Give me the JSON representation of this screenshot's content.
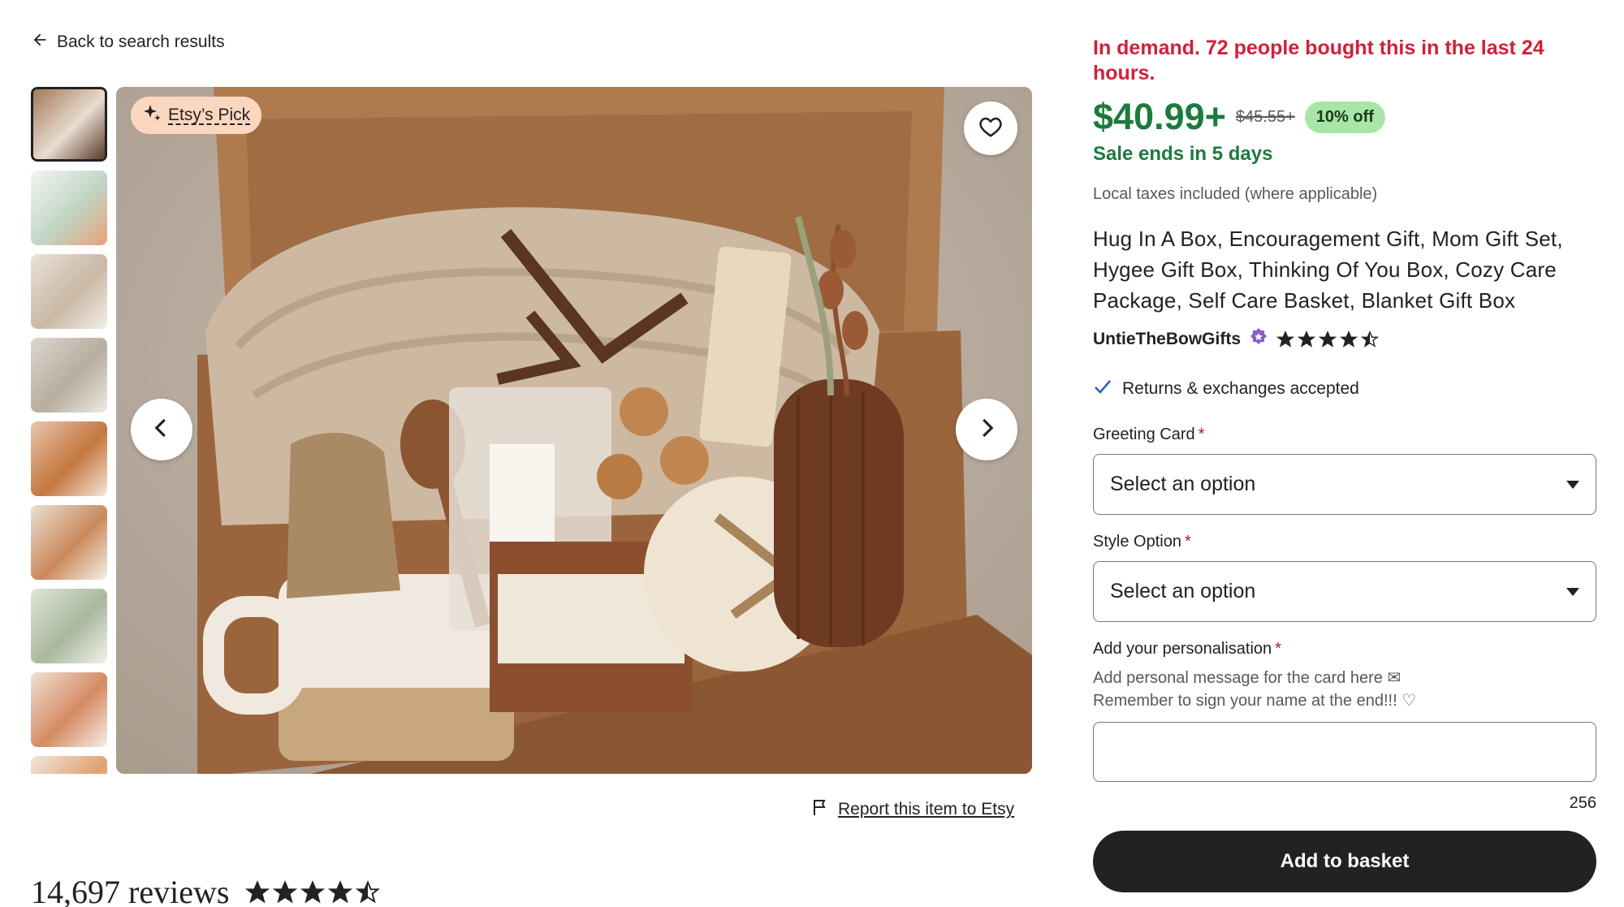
{
  "nav": {
    "back_label": "Back to search results",
    "back_icon": "arrow-left-icon"
  },
  "gallery": {
    "badge_label": "Etsy’s Pick",
    "thumbnails": [
      {
        "colors": [
          "#a27a5a",
          "#e8dcd0",
          "#5a3a28"
        ]
      },
      {
        "colors": [
          "#f4f4f2",
          "#bfd6c4",
          "#e8a07a"
        ]
      },
      {
        "colors": [
          "#e9e2d8",
          "#c9b8a4",
          "#f3eee7"
        ]
      },
      {
        "colors": [
          "#dcd7cf",
          "#b7ad9f",
          "#efebe4"
        ]
      },
      {
        "colors": [
          "#e8c6ae",
          "#c4773e",
          "#f5e6d8"
        ]
      },
      {
        "colors": [
          "#eadfd3",
          "#c98a5b",
          "#f6efe7"
        ]
      },
      {
        "colors": [
          "#dfe6d8",
          "#a9b89d",
          "#f1f3ec"
        ]
      },
      {
        "colors": [
          "#efe1d6",
          "#d48a62",
          "#f7eee7"
        ]
      },
      {
        "colors": [
          "#f2e6da",
          "#e0a070",
          "#fbf3ec"
        ]
      }
    ]
  },
  "report": {
    "label": "Report this item to Etsy"
  },
  "reviews": {
    "count_label": "14,697 reviews",
    "rating": 4.5
  },
  "listing": {
    "demand_text": "In demand. 72 people bought this in the last 24 hours.",
    "price": "$40.99+",
    "old_price": "$45.55+",
    "discount_badge": "10% off",
    "sale_ends": "Sale ends in 5 days",
    "taxes_note": "Local taxes included (where applicable)",
    "title": "Hug In A Box, Encouragement Gift, Mom Gift Set, Hygee Gift Box, Thinking Of You Box, Cozy Care Package, Self Care Basket, Blanket Gift Box",
    "shop_name": "UntieTheBowGifts",
    "shop_rating": 4.5,
    "returns_text": "Returns & exchanges accepted"
  },
  "form": {
    "greeting_card_label": "Greeting Card",
    "greeting_card_value": "Select an option",
    "style_label": "Style Option",
    "style_value": "Select an option",
    "personalisation_label": "Add your personalisation",
    "personalisation_hint_1": "Add personal message for the card here ✉",
    "personalisation_hint_2": "Remember to sign your name at the end!!! ♡",
    "personalisation_value": "",
    "char_count": "256",
    "required_mark": "*",
    "add_to_basket_label": "Add to basket"
  },
  "colors": {
    "demand": "#d0213a",
    "price": "#1d7a3d",
    "badge_bg": "#a8e6a8",
    "pick_badge_bg": "#fcd7c0",
    "button_bg": "#222222"
  }
}
